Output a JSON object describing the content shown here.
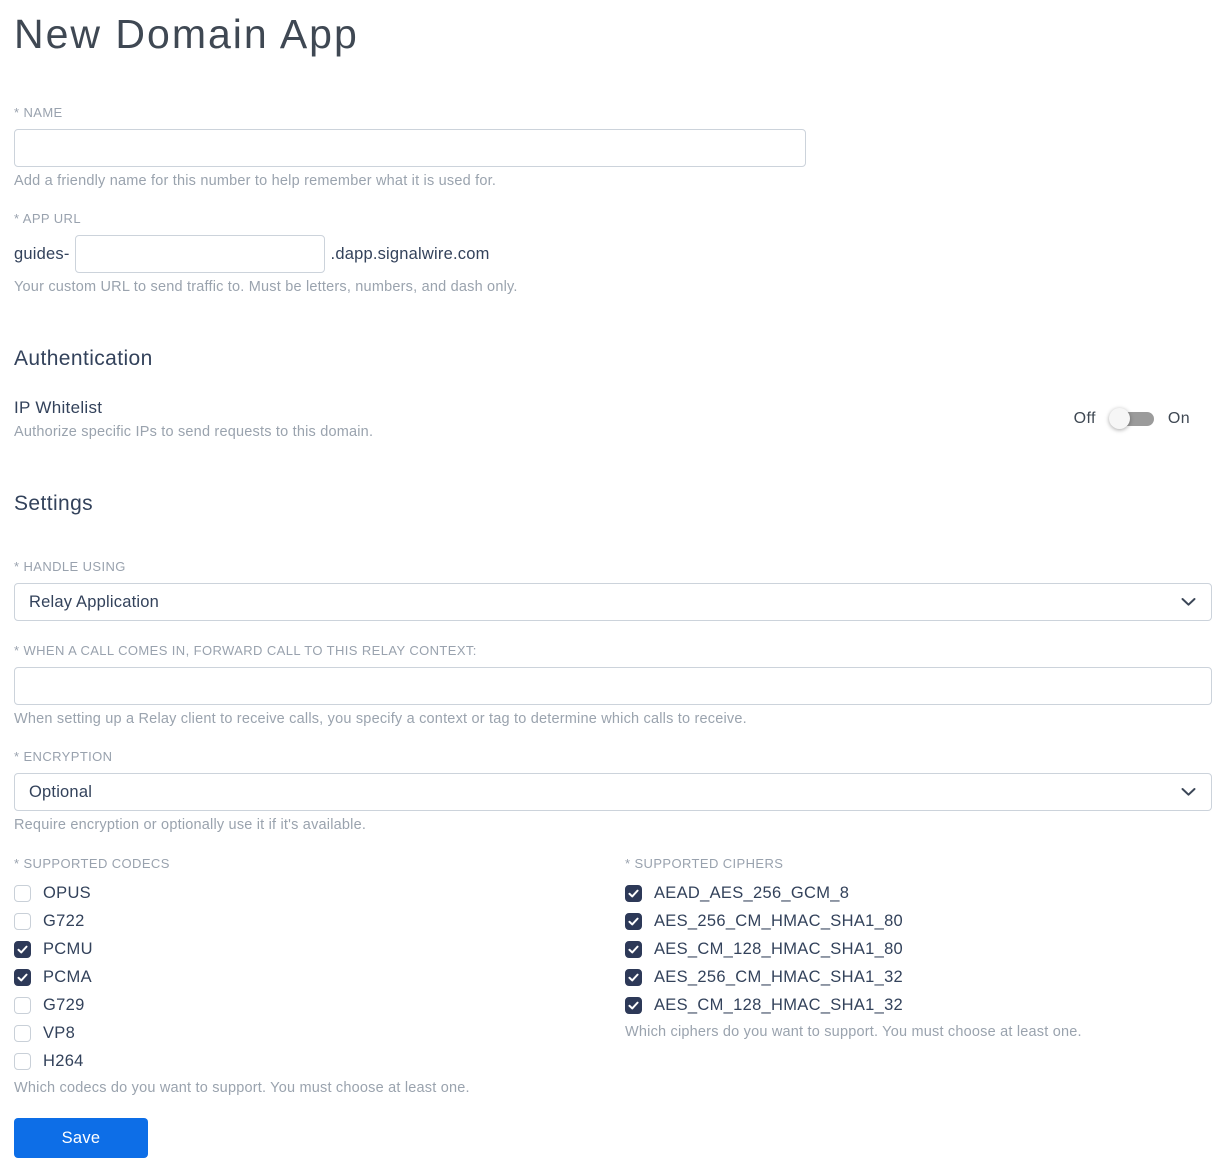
{
  "page": {
    "title": "New Domain App"
  },
  "fields": {
    "name": {
      "label": "* NAME",
      "value": "",
      "help": "Add a friendly name for this number to help remember what it is used for."
    },
    "app_url": {
      "label": "* APP URL",
      "prefix": "guides-",
      "value": "",
      "suffix": ".dapp.signalwire.com",
      "help": "Your custom URL to send traffic to. Must be letters, numbers, and dash only."
    }
  },
  "authentication": {
    "heading": "Authentication",
    "ip_whitelist": {
      "label": "IP Whitelist",
      "help": "Authorize specific IPs to send requests to this domain.",
      "off_label": "Off",
      "on_label": "On",
      "enabled": false
    }
  },
  "settings": {
    "heading": "Settings",
    "handle_using": {
      "label": "* HANDLE USING",
      "value": "Relay Application"
    },
    "relay_context": {
      "label": "* WHEN A CALL COMES IN, FORWARD CALL TO THIS RELAY CONTEXT:",
      "value": "",
      "help": "When setting up a Relay client to receive calls, you specify a context or tag to determine which calls to receive."
    },
    "encryption": {
      "label": "* ENCRYPTION",
      "value": "Optional",
      "help": "Require encryption or optionally use it if it's available."
    },
    "codecs": {
      "label": "* SUPPORTED CODECS",
      "help": "Which codecs do you want to support. You must choose at least one.",
      "items": [
        {
          "label": "OPUS",
          "checked": false
        },
        {
          "label": "G722",
          "checked": false
        },
        {
          "label": "PCMU",
          "checked": true
        },
        {
          "label": "PCMA",
          "checked": true
        },
        {
          "label": "G729",
          "checked": false
        },
        {
          "label": "VP8",
          "checked": false
        },
        {
          "label": "H264",
          "checked": false
        }
      ]
    },
    "ciphers": {
      "label": "* SUPPORTED CIPHERS",
      "help": "Which ciphers do you want to support. You must choose at least one.",
      "items": [
        {
          "label": "AEAD_AES_256_GCM_8",
          "checked": true
        },
        {
          "label": "AES_256_CM_HMAC_SHA1_80",
          "checked": true
        },
        {
          "label": "AES_CM_128_HMAC_SHA1_80",
          "checked": true
        },
        {
          "label": "AES_256_CM_HMAC_SHA1_32",
          "checked": true
        },
        {
          "label": "AES_CM_128_HMAC_SHA1_32",
          "checked": true
        }
      ]
    }
  },
  "actions": {
    "save_label": "Save"
  },
  "colors": {
    "primary_button": "#0d6ee7",
    "checkbox_checked": "#2d3958",
    "text_dark": "#33425b",
    "text_muted": "#9aa3ae",
    "input_border": "#ccd3db",
    "toggle_track": "#9b9b9b"
  }
}
